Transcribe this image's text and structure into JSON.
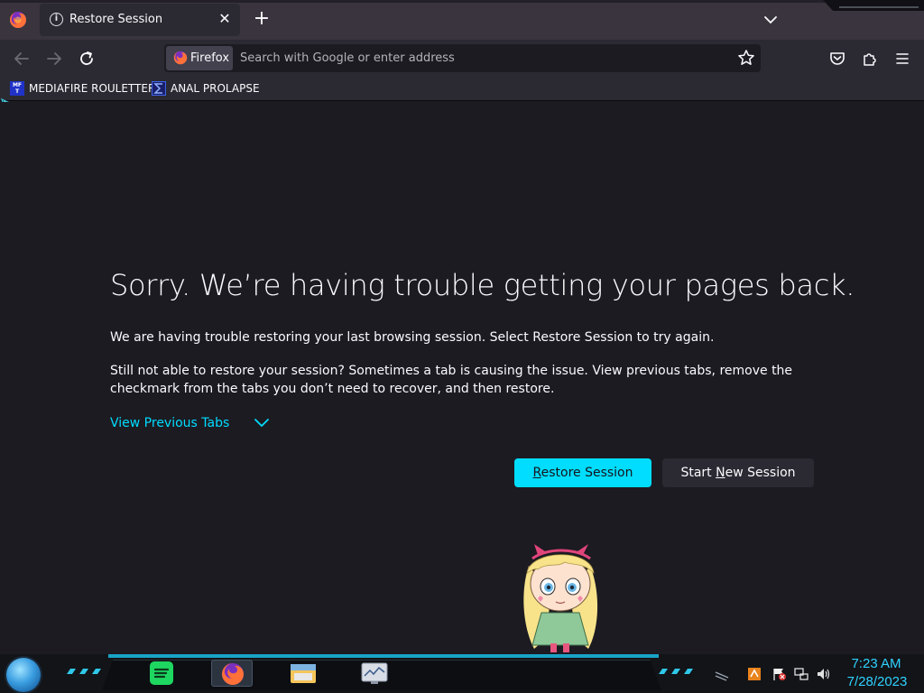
{
  "window": {
    "tab": {
      "title": "Restore Session"
    },
    "icons": {
      "menu": "firefox-logo-icon",
      "tab_info": "info-icon",
      "tab_close": "close-icon",
      "new_tab": "plus-icon",
      "tab_list": "chevron-down-icon"
    }
  },
  "navbar": {
    "identity_label": "Firefox",
    "search_placeholder": "Search with Google or enter address",
    "icons": [
      "back-arrow-icon",
      "forward-arrow-icon",
      "reload-icon",
      "bookmark-star-icon",
      "pocket-icon",
      "extensions-icon",
      "hamburger-menu-icon"
    ]
  },
  "bookmarks": {
    "items": [
      {
        "label": "MEDIAFIRE ROULETTER",
        "icon_text": "MF\nT"
      },
      {
        "label": "ANAL PROLAPSE"
      }
    ]
  },
  "page": {
    "title": "Sorry. We’re having trouble getting your pages back.",
    "paragraph1": "We are having trouble restoring your last browsing session. Select Restore Session to try again.",
    "paragraph2": "Still not able to restore your session? Sometimes a tab is causing the issue. View previous tabs, remove the checkmark from the tabs you don’t need to recover, and then restore.",
    "view_previous_tabs": "View Previous Tabs",
    "restore_button": {
      "accesskey": "R",
      "rest": "estore Session"
    },
    "new_session_button": {
      "before": "Start ",
      "accesskey": "N",
      "rest": "ew Session"
    }
  },
  "colors": {
    "accent": "#00ddff",
    "background": "#1c1b22",
    "toolbar": "#2b2a33",
    "clock": "#2fd2ff"
  },
  "taskbar": {
    "apps": [
      "spotify-icon",
      "firefox-icon",
      "file-explorer-icon",
      "system-monitor-icon"
    ],
    "tray": [
      "chevron-icon",
      "app-tray-icon",
      "action-center-flag-icon",
      "network-icon",
      "volume-icon"
    ],
    "clock": {
      "time": "7:23 AM",
      "date": "7/28/2023"
    }
  }
}
